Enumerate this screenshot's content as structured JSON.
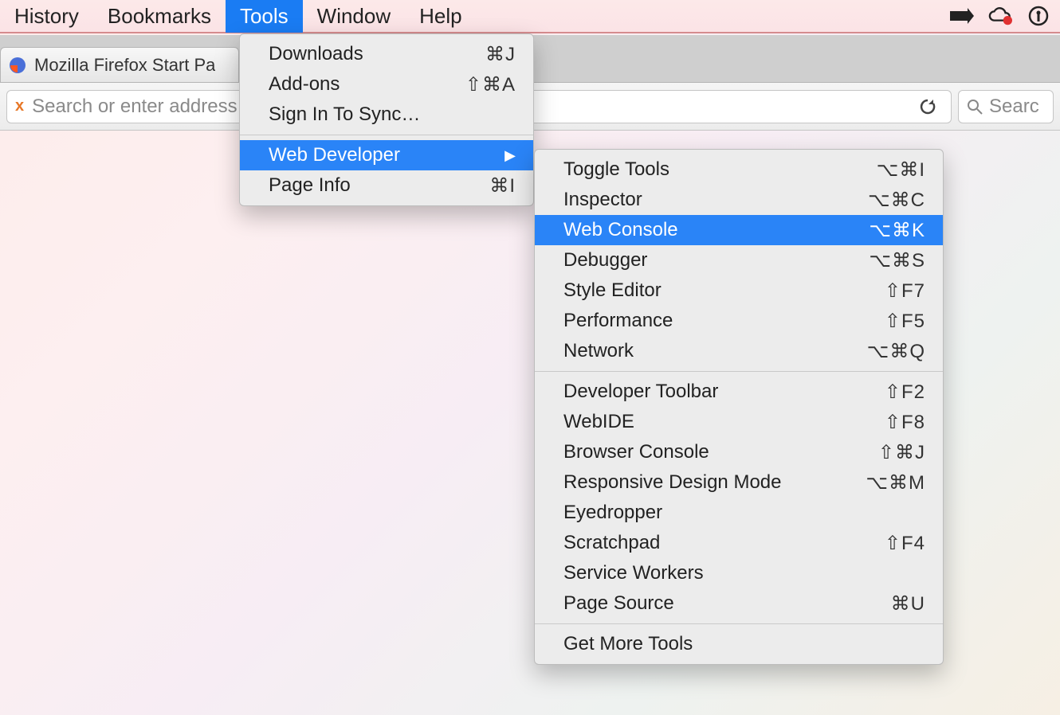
{
  "menubar": {
    "items": [
      {
        "label": "History"
      },
      {
        "label": "Bookmarks"
      },
      {
        "label": "Tools",
        "selected": true
      },
      {
        "label": "Window"
      },
      {
        "label": "Help"
      }
    ]
  },
  "tab": {
    "title": "Mozilla Firefox Start Pa"
  },
  "urlbar": {
    "prefix": "x",
    "placeholder": "Search or enter address"
  },
  "searchbar": {
    "placeholder": "Searc"
  },
  "tools_menu": {
    "items": [
      {
        "label": "Downloads",
        "shortcut": "⌘J"
      },
      {
        "label": "Add-ons",
        "shortcut": "⇧⌘A"
      },
      {
        "label": "Sign In To Sync…",
        "shortcut": ""
      }
    ],
    "sep1": true,
    "items2": [
      {
        "label": "Web Developer",
        "shortcut": "",
        "submenu": true,
        "selected": true
      },
      {
        "label": "Page Info",
        "shortcut": "⌘I"
      }
    ]
  },
  "webdev_menu": {
    "group1": [
      {
        "label": "Toggle Tools",
        "shortcut": "⌥⌘I"
      },
      {
        "label": "Inspector",
        "shortcut": "⌥⌘C"
      },
      {
        "label": "Web Console",
        "shortcut": "⌥⌘K",
        "selected": true
      },
      {
        "label": "Debugger",
        "shortcut": "⌥⌘S"
      },
      {
        "label": "Style Editor",
        "shortcut": "⇧F7"
      },
      {
        "label": "Performance",
        "shortcut": "⇧F5"
      },
      {
        "label": "Network",
        "shortcut": "⌥⌘Q"
      }
    ],
    "group2": [
      {
        "label": "Developer Toolbar",
        "shortcut": "⇧F2"
      },
      {
        "label": "WebIDE",
        "shortcut": "⇧F8"
      },
      {
        "label": "Browser Console",
        "shortcut": "⇧⌘J"
      },
      {
        "label": "Responsive Design Mode",
        "shortcut": "⌥⌘M"
      },
      {
        "label": "Eyedropper",
        "shortcut": ""
      },
      {
        "label": "Scratchpad",
        "shortcut": "⇧F4"
      },
      {
        "label": "Service Workers",
        "shortcut": ""
      },
      {
        "label": "Page Source",
        "shortcut": "⌘U"
      }
    ],
    "group3": [
      {
        "label": "Get More Tools",
        "shortcut": ""
      }
    ]
  }
}
